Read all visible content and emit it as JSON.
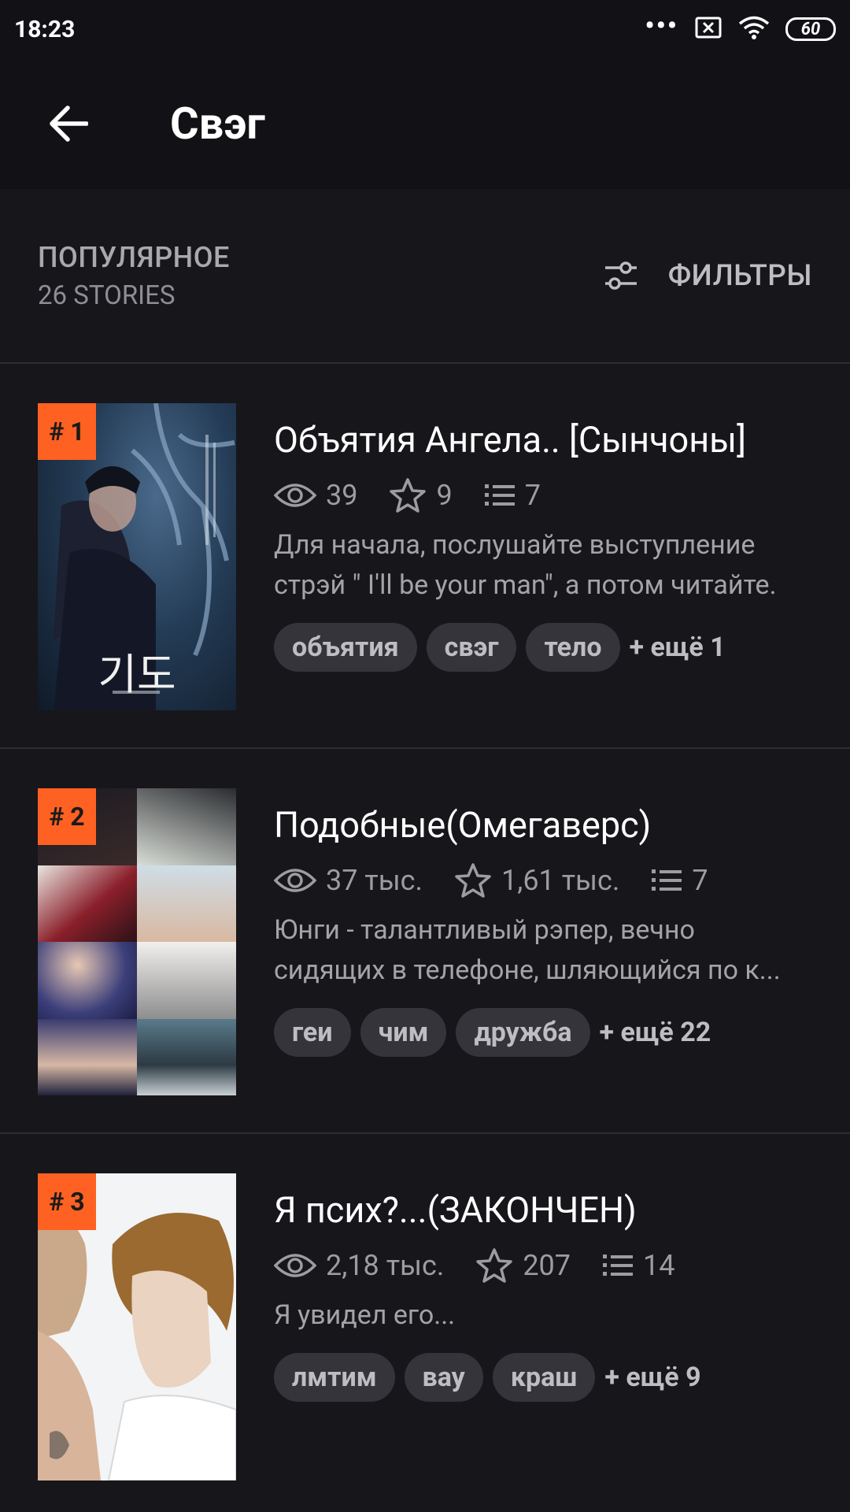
{
  "status_bar": {
    "time": "18:23",
    "dots": "•••",
    "battery": "60",
    "icons": [
      "sim-x-icon",
      "wifi-icon",
      "battery-icon"
    ]
  },
  "header": {
    "back_icon": "arrow-left-icon",
    "title": "Свэг"
  },
  "section": {
    "title": "ПОПУЛЯРНОЕ",
    "count": "26 STORIES",
    "filter_label": "ФИЛЬТРЫ",
    "filter_icon": "sliders-icon"
  },
  "colors": {
    "background": "#121115",
    "card": "#17161b",
    "rank_badge": "#ff6122",
    "tag_bg": "#35343a"
  },
  "stories": [
    {
      "rank": "# 1",
      "title": "Объятия Ангела.. [Сынчоны]",
      "views": "39",
      "votes": "9",
      "parts": "7",
      "desc_line1": "Для начала, послушайте выступление",
      "desc_line2": "стрэй \" I'll be your man\", а потом читайте.",
      "tags": [
        "объятия",
        "свэг",
        "тело"
      ],
      "more": "+ ещё 1",
      "cover_text": "기도"
    },
    {
      "rank": "# 2",
      "title": "Подобные(Омегаверс)",
      "views": "37 тыс.",
      "votes": "1,61 тыс.",
      "parts": "7",
      "desc_line1": "Юнги - талантливый рэпер, вечно",
      "desc_line2": "сидящих в телефоне, шляющийся по к...",
      "tags": [
        "геи",
        "чим",
        "дружба"
      ],
      "more": "+ ещё 22"
    },
    {
      "rank": "# 3",
      "title": "Я псих?...(ЗАКОНЧЕН)",
      "views": "2,18 тыс.",
      "votes": "207",
      "parts": "14",
      "desc_line1": "Я увидел его...",
      "tags": [
        "лмтим",
        "вау",
        "краш"
      ],
      "more": "+ ещё 9"
    }
  ]
}
